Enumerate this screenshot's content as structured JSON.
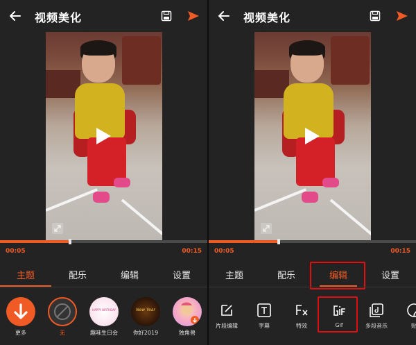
{
  "screens": [
    {
      "title": "视频美化",
      "time_start": "00:05",
      "time_end": "00:15",
      "progress": 0.33,
      "active_tab": 0,
      "tabs": [
        "主题",
        "配乐",
        "编辑",
        "设置"
      ],
      "themes": [
        {
          "label": "更多",
          "icon": "download-arrow-icon",
          "color": "#f05a24"
        },
        {
          "label": "无",
          "icon": "none-slash-icon",
          "selected": true
        },
        {
          "label": "趣味生日会",
          "icon": "birthday-theme-thumb",
          "badge": "HAPPY BIRTHDAY"
        },
        {
          "label": "你好2019",
          "icon": "new-year-theme-thumb",
          "badge": "New Year"
        },
        {
          "label": "独角兽",
          "icon": "unicorn-theme-thumb"
        }
      ]
    },
    {
      "title": "视频美化",
      "time_start": "00:05",
      "time_end": "00:15",
      "progress": 0.33,
      "active_tab": 2,
      "tabs": [
        "主题",
        "配乐",
        "编辑",
        "设置"
      ],
      "edit_tools": [
        {
          "label": "片段编辑",
          "icon": "clip-edit-icon"
        },
        {
          "label": "字幕",
          "icon": "subtitle-icon"
        },
        {
          "label": "特效",
          "icon": "effects-fx-icon"
        },
        {
          "label": "Gif",
          "icon": "gif-icon",
          "highlighted": true
        },
        {
          "label": "多段音乐",
          "icon": "multi-music-icon"
        },
        {
          "label": "贴",
          "icon": "sticker-icon"
        }
      ]
    }
  ],
  "colors": {
    "accent": "#f05a24",
    "highlight": "#e01010",
    "background": "#232323"
  }
}
